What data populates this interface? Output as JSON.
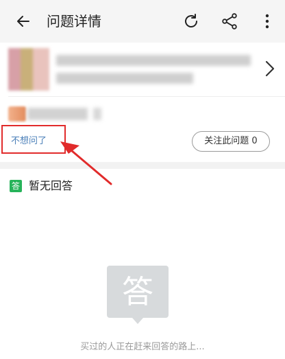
{
  "appbar": {
    "title": "问题详情",
    "icons": [
      "back-arrow-icon",
      "refresh-icon",
      "share-icon",
      "more-vertical-icon"
    ]
  },
  "product": {
    "icons": [
      "chevron-right-icon"
    ]
  },
  "question": {
    "dont_ask_label": "不想问了",
    "follow_label": "关注此问题 0"
  },
  "answers": {
    "badge_text": "答",
    "title": "暂无回答",
    "empty_icon_text": "答",
    "empty_message": "买过的人正在赶来回答的路上..."
  },
  "colors": {
    "accent_link": "#4a7fb8",
    "highlight": "#e12b2b",
    "badge_green": "#27b35a"
  }
}
